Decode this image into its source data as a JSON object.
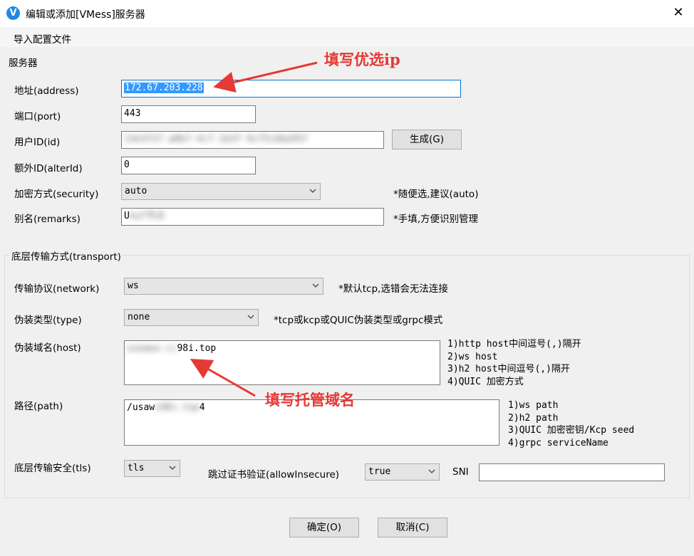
{
  "window": {
    "title": "编辑或添加[VMess]服务器",
    "close_glyph": "✕",
    "app_icon_glyph": "V"
  },
  "menu": {
    "import_config": "导入配置文件"
  },
  "server": {
    "section_title": "服务器",
    "address_label": "地址(address)",
    "address_value": "172.67.203.228",
    "port_label": "端口(port)",
    "port_value": "443",
    "id_label": "用户ID(id)",
    "id_value": "13e3f27-a8b7-4c7-1b3f-9cf5c6be95f",
    "generate_button": "生成(G)",
    "alterid_label": "额外ID(alterId)",
    "alterid_value": "0",
    "security_label": "加密方式(security)",
    "security_value": "auto",
    "security_hint": "*随便选,建议(auto)",
    "remarks_label": "别名(remarks)",
    "remarks_value": "U",
    "remarks_value_hidden": "kuf节点",
    "remarks_hint": "*手填,方便识别管理"
  },
  "transport": {
    "section_title": "底层传输方式(transport)",
    "network_label": "传输协议(network)",
    "network_value": "ws",
    "network_hint": "*默认tcp,选错会无法连接",
    "type_label": "伪装类型(type)",
    "type_value": "none",
    "type_hint": "*tcp或kcp或QUIC伪装类型或grpc模式",
    "host_label": "伪装域名(host)",
    "host_value_hidden": "usa",
    "host_value_blur": "awx.cc",
    "host_value": "98i.top",
    "host_notes": [
      "1)http host中间逗号(,)隔开",
      "2)ws host",
      "3)h2 host中间逗号(,)隔开",
      "4)QUIC 加密方式"
    ],
    "path_label": "路径(path)",
    "path_value": "/u",
    "path_value_mid": "saw",
    "path_value_blur": "s98i.top",
    "path_value_end": "4",
    "path_notes": [
      "1)ws path",
      "2)h2 path",
      "3)QUIC 加密密钥/Kcp seed",
      "4)grpc serviceName"
    ],
    "tls_label": "底层传输安全(tls)",
    "tls_value": "tls",
    "allow_insecure_label": "跳过证书验证(allowInsecure)",
    "allow_insecure_value": "true",
    "sni_label": "SNI",
    "sni_value": ""
  },
  "footer": {
    "ok_button": "确定(O)",
    "cancel_button": "取消(C)"
  },
  "annotations": {
    "fill_ip": "填写优选ip",
    "fill_domain": "填写托管域名",
    "color": "#e53935"
  },
  "colors": {
    "accent": "#0078d7",
    "selection": "#3399ff",
    "annotation": "#e53935"
  }
}
